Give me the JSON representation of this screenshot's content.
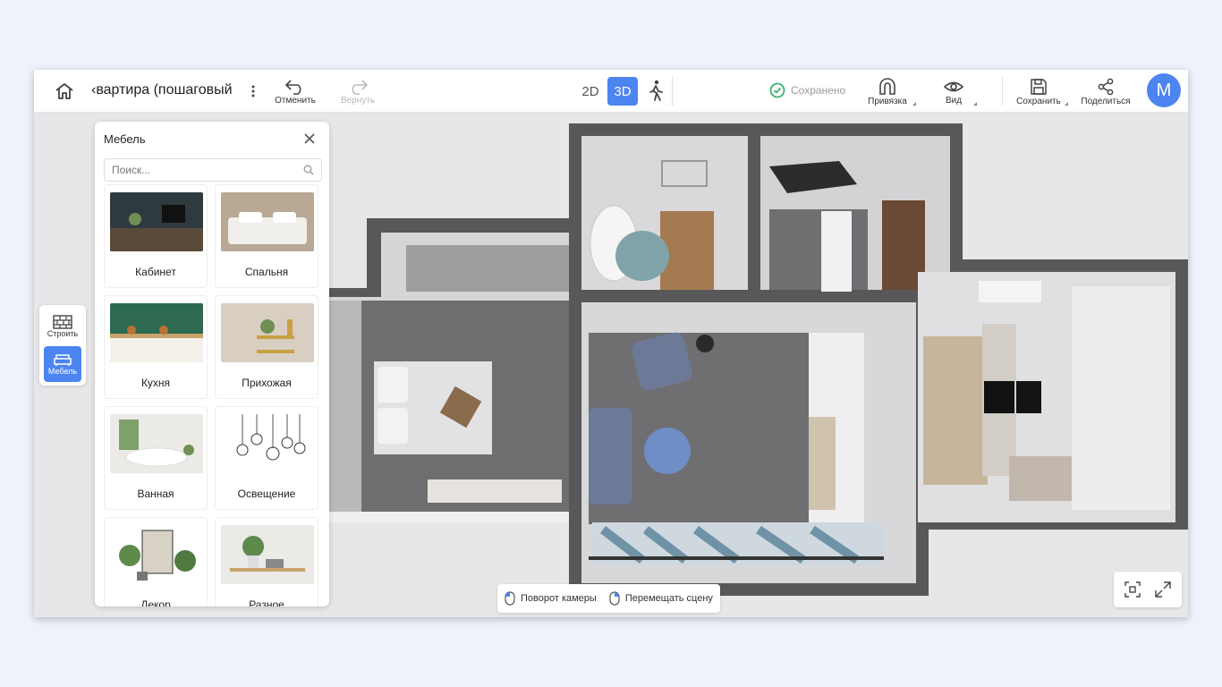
{
  "header": {
    "title": "‹вартира (пошаговый",
    "undo_label": "Отменить",
    "redo_label": "Вернуть",
    "mode_2d": "2D",
    "mode_3d": "3D",
    "status_saved": "Сохранено",
    "snap_label": "Привязка",
    "view_label": "Вид",
    "save_label": "Сохранить",
    "share_label": "Поделиться",
    "avatar_initial": "M"
  },
  "left_tools": {
    "build_label": "Строить",
    "furniture_label": "Мебель"
  },
  "panel": {
    "title": "Мебель",
    "search_placeholder": "Поиск...",
    "categories": [
      {
        "label": "Кабинет",
        "icon": "office-thumb"
      },
      {
        "label": "Спальня",
        "icon": "bedroom-thumb"
      },
      {
        "label": "Кухня",
        "icon": "kitchen-thumb"
      },
      {
        "label": "Прихожая",
        "icon": "hallway-thumb"
      },
      {
        "label": "Ванная",
        "icon": "bathroom-thumb"
      },
      {
        "label": "Освещение",
        "icon": "lighting-thumb"
      },
      {
        "label": "Декор",
        "icon": "decor-thumb"
      },
      {
        "label": "Разное",
        "icon": "misc-thumb"
      }
    ]
  },
  "hints": {
    "rotate_camera": "Поворот камеры",
    "move_scene": "Перемещать сцену"
  },
  "colors": {
    "accent": "#4c84f0",
    "saved_check": "#3cb371"
  }
}
